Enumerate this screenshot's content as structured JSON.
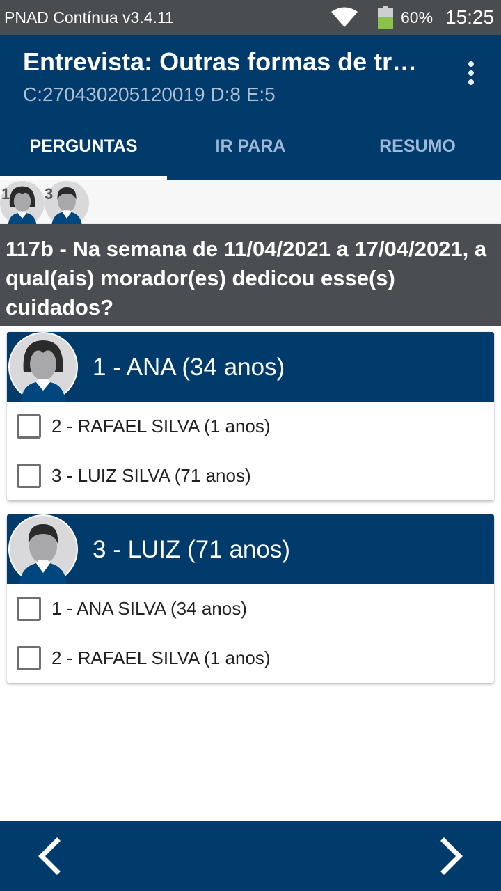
{
  "status_bar": {
    "app_name": "PNAD Contínua v3.4.11",
    "battery": "60%",
    "time": "15:25",
    "battery_level": 0.6,
    "icons": [
      "wifi-icon",
      "battery-icon"
    ]
  },
  "header": {
    "title": "Entrevista: Outras formas de trabalho",
    "subtitle": "C:270430205120019 D:8 E:5",
    "menu_icon": "more-vert-icon"
  },
  "tabs": [
    {
      "label": "PERGUNTAS",
      "active": true
    },
    {
      "label": "IR PARA",
      "active": false
    },
    {
      "label": "RESUMO",
      "active": false
    }
  ],
  "persons_strip": [
    {
      "number": "1",
      "gender": "female"
    },
    {
      "number": "3",
      "gender": "male"
    }
  ],
  "question": {
    "text": "117b - Na semana de 11/04/2021 a 17/04/2021, a qual(ais) morador(es) dedicou esse(s) cuidados?"
  },
  "cards": [
    {
      "title": "1 - ANA (34 anos)",
      "gender": "female",
      "options": [
        {
          "label": "2 - RAFAEL SILVA (1 anos)",
          "checked": false
        },
        {
          "label": "3 - LUIZ SILVA (71 anos)",
          "checked": false
        }
      ]
    },
    {
      "title": "3 - LUIZ (71 anos)",
      "gender": "male",
      "options": [
        {
          "label": "1 - ANA SILVA (34 anos)",
          "checked": false
        },
        {
          "label": "2 - RAFAEL SILVA (1 anos)",
          "checked": false
        }
      ]
    }
  ],
  "bottom_nav": {
    "prev_icon": "chevron-left-icon",
    "next_icon": "chevron-right-icon"
  },
  "colors": {
    "primary": "#003b6c",
    "status_bar": "#4a4d50",
    "question_bg": "#4a4d51",
    "tab_inactive": "#9fb8d6",
    "battery_fill": "#8bc34a"
  }
}
